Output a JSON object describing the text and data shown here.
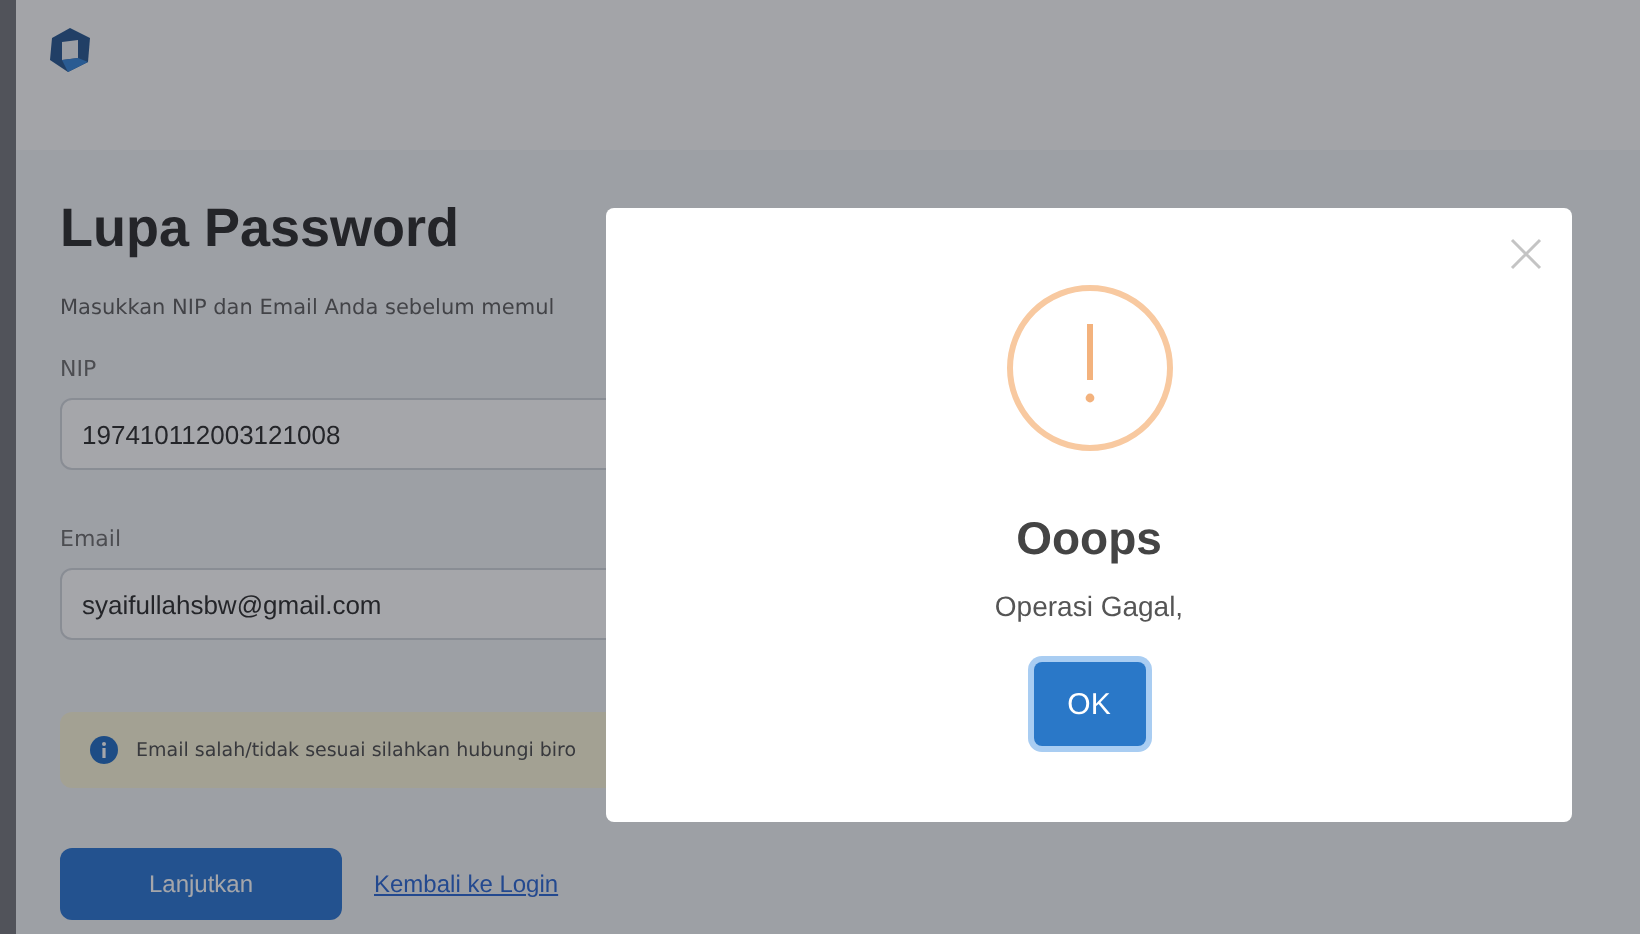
{
  "page": {
    "title": "Lupa Password",
    "subtitle": "Masukkan NIP dan Email Anda sebelum memul",
    "fields": [
      {
        "label": "NIP",
        "value": "197410112003121008"
      },
      {
        "label": "Email",
        "value": "syaifullahsbw@gmail.com"
      }
    ],
    "alert": "Email salah/tidak sesuai silahkan hubungi biro",
    "submit": "Lanjutkan",
    "link": "Kembali ke Login"
  },
  "dialog": {
    "title": "Ooops",
    "message": "Operasi Gagal,",
    "button": "OK"
  }
}
